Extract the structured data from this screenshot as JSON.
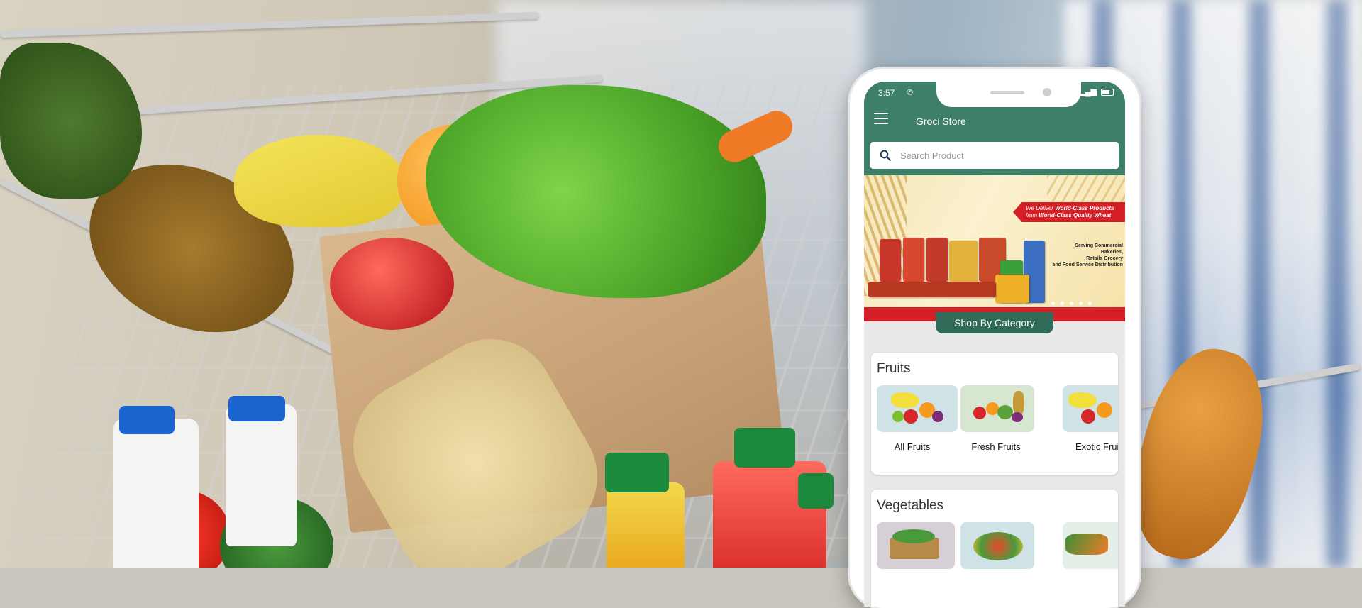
{
  "status_bar": {
    "time": "3:57",
    "left_icons": [
      "whatsapp-icon"
    ],
    "right_icons": [
      "signal-icon",
      "battery-icon"
    ]
  },
  "app_bar": {
    "title": "Groci Store",
    "menu_icon": "hamburger-menu-icon"
  },
  "search": {
    "placeholder": "Search Product",
    "icon": "search-icon"
  },
  "banner": {
    "headline_line1_prefix": "We Deliver ",
    "headline_line1_bold": "World-Class Products",
    "headline_line2_prefix": "from ",
    "headline_line2_bold": "World-Class Quality Wheat",
    "side_line1": "Serving Commercial Bakeries,",
    "side_line2": "Retails Grocery",
    "side_line3": "and Food Service Distribution",
    "slide_count": 5
  },
  "shop_by_category": "Shop By Category",
  "sections": [
    {
      "title": "Fruits",
      "items": [
        {
          "label": "All Fruits"
        },
        {
          "label": "Fresh Fruits"
        },
        {
          "label": "Exotic Fruits"
        }
      ]
    },
    {
      "title": "Vegetables",
      "items": [
        {
          "label": ""
        },
        {
          "label": ""
        },
        {
          "label": ""
        }
      ]
    }
  ],
  "colors": {
    "brand_green": "#3e7f67",
    "pill_green": "#2f6b58",
    "banner_red": "#d41f26"
  }
}
